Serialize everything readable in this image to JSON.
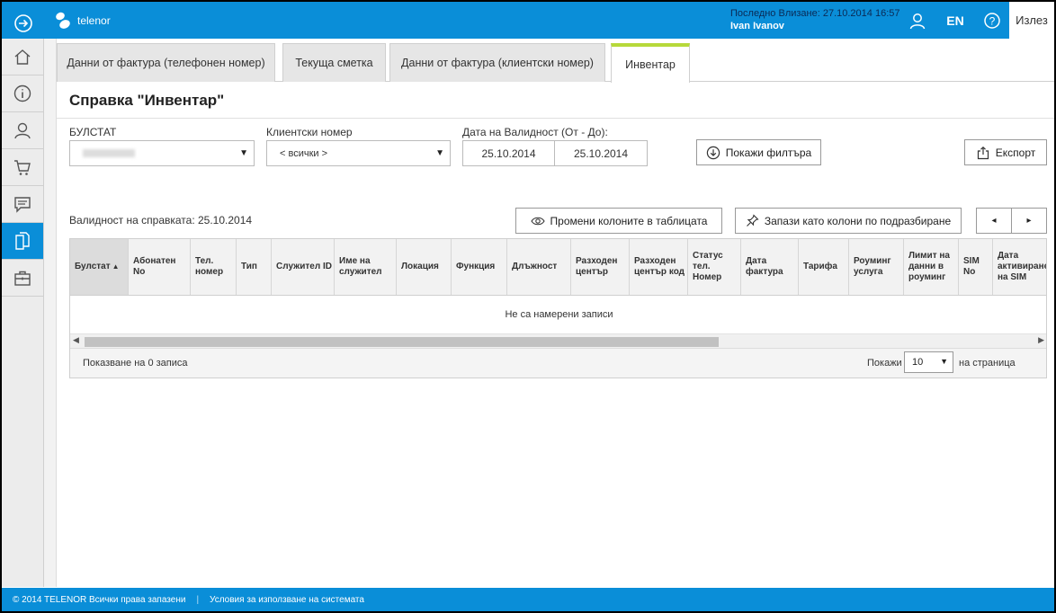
{
  "header": {
    "brand": "telenor",
    "last_login_label": "Последно Влизане: 27.10.2014 16:57",
    "user_name": "Ivan Ivanov",
    "lang": "EN",
    "exit": "Излез",
    "colors": {
      "primary": "#0a8ed8",
      "tab_accent": "#b6d93a"
    }
  },
  "sidebar": {
    "items": [
      {
        "icon": "home-icon"
      },
      {
        "icon": "info-icon"
      },
      {
        "icon": "user-icon"
      },
      {
        "icon": "cart-icon"
      },
      {
        "icon": "chat-icon"
      },
      {
        "icon": "documents-icon",
        "active": true
      },
      {
        "icon": "briefcase-icon"
      }
    ]
  },
  "tabs": [
    {
      "label": "Данни от фактура (телефонен номер)"
    },
    {
      "label": "Текуща сметка"
    },
    {
      "label": "Данни от фактура (клиентски номер)"
    },
    {
      "label": "Инвентар",
      "active": true
    }
  ],
  "page": {
    "title": "Справка \"Инвентар\"",
    "filters": {
      "bulstat_label": "БУЛСТАТ",
      "client_label": "Клиентски номер",
      "client_value": "< всички >",
      "date_label": "Дата на Валидност (От - До):",
      "date_from": "25.10.2014",
      "date_to": "25.10.2014",
      "show_filter_btn": "Покажи филтъра",
      "export_btn": "Експорт"
    },
    "validity": "Валидност на справката: 25.10.2014",
    "change_columns_btn": "Промени колоните в таблицата",
    "save_columns_btn": "Запази като колони по подразбиране",
    "prev_btn": "◂",
    "next_btn": "▸"
  },
  "table": {
    "columns": [
      "Булстат",
      "Абонатен No",
      "Тел. номер",
      "Тип",
      "Служител ID",
      "Име на служител",
      "Локация",
      "Функция",
      "Длъжност",
      "Разходен център",
      "Разходен център код",
      "Статус тел. Номер",
      "Дата фактура",
      "Тарифа",
      "Роуминг услуга",
      "Лимит на данни в роуминг",
      "SIM No",
      "Дата активиране на SIM"
    ],
    "empty_message": "Не са намерени записи",
    "footer_left": "Показване на 0 записа",
    "show_label": "Покажи",
    "page_size": "10",
    "per_page_label": "на страница"
  },
  "footer": {
    "copyright": "© 2014 TELENOR Всички права запазени",
    "terms": "Условия за използване на системата"
  }
}
